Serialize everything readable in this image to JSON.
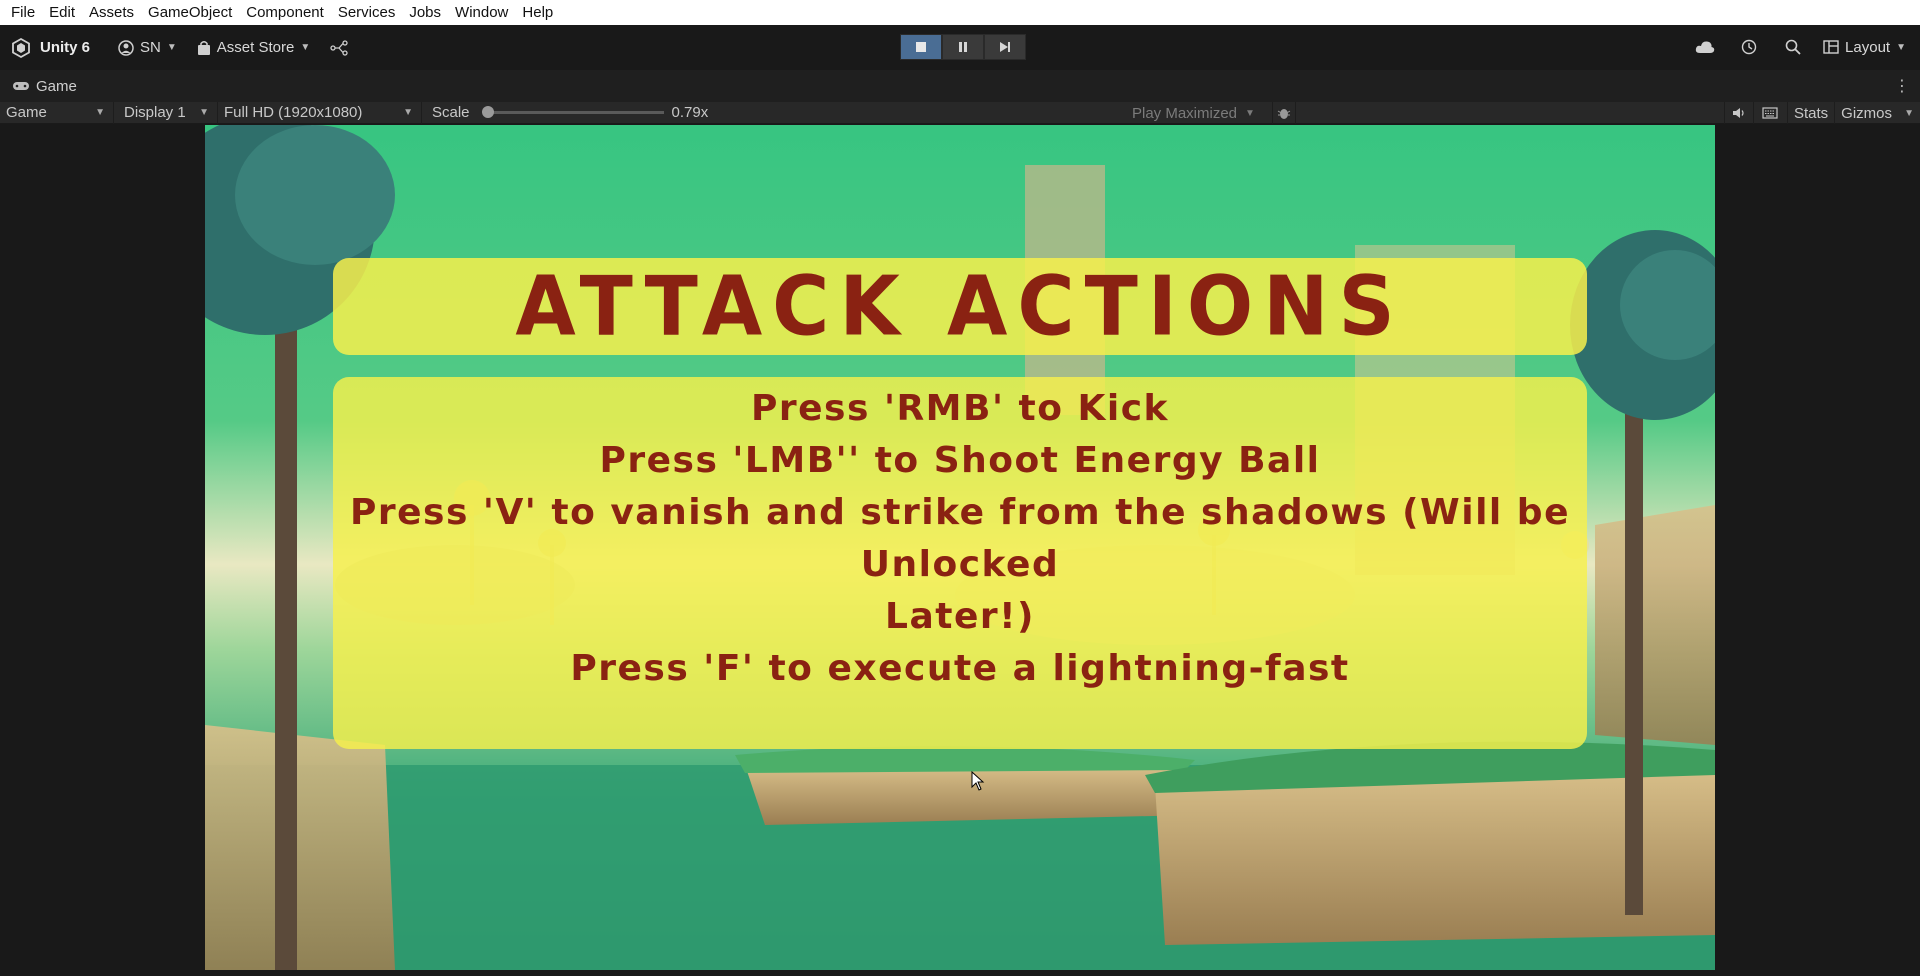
{
  "menubar": {
    "items": [
      "File",
      "Edit",
      "Assets",
      "GameObject",
      "Component",
      "Services",
      "Jobs",
      "Window",
      "Help"
    ]
  },
  "toolbar": {
    "unity_label": "Unity 6",
    "account_label": "SN",
    "asset_store_label": "Asset Store",
    "layout_label": "Layout"
  },
  "tab": {
    "label": "Game"
  },
  "game_toolbar": {
    "view_mode": "Game",
    "display": "Display 1",
    "resolution": "Full HD (1920x1080)",
    "scale_label": "Scale",
    "scale_value": "0.79x",
    "play_mode": "Play Maximized",
    "stats_label": "Stats",
    "gizmos_label": "Gizmos"
  },
  "game": {
    "title": "ATTACK ACTIONS",
    "lines": [
      "Press 'RMB' to Kick",
      "Press 'LMB'' to Shoot Energy Ball",
      "Press 'V' to vanish and strike from the shadows (Will be Unlocked",
      "Later!)",
      "Press 'F' to execute a lightning-fast"
    ]
  },
  "colors": {
    "panel_yellow": "#f7f04c",
    "text_red": "#8a2212",
    "editor_dark": "#191919"
  }
}
